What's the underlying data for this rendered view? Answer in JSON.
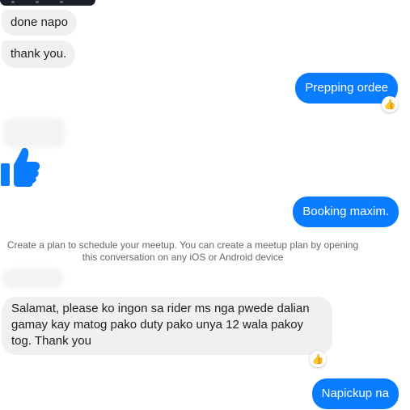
{
  "colors": {
    "incoming_bg": "#f0f0f0",
    "outgoing_bg": "#0a7cff",
    "like_blue": "#0a7cff",
    "notice_text": "#65676b"
  },
  "messages": [
    {
      "side": "received",
      "text": "done napo"
    },
    {
      "side": "received",
      "text": "thank you."
    },
    {
      "side": "sent",
      "text": "Prepping ordee",
      "reaction": "thumbs-up"
    },
    {
      "side": "received",
      "type": "like-sticker",
      "icon": "thumbs-up-icon"
    },
    {
      "side": "sent",
      "text": "Booking maxim."
    },
    {
      "side": "received",
      "text_lines": [
        "Salamat, please ko ingon sa rider ms nga pwede dalian",
        "gamay kay matog pako duty pako unya 12 wala pakoy",
        "tog. Thank you"
      ],
      "reaction": "thumbs-up"
    },
    {
      "side": "sent",
      "text": "Napickup na"
    }
  ],
  "notice": {
    "line1": "Create a plan to schedule your meetup. You can create a meetup plan by opening",
    "line2": "this conversation on any iOS or Android device"
  }
}
